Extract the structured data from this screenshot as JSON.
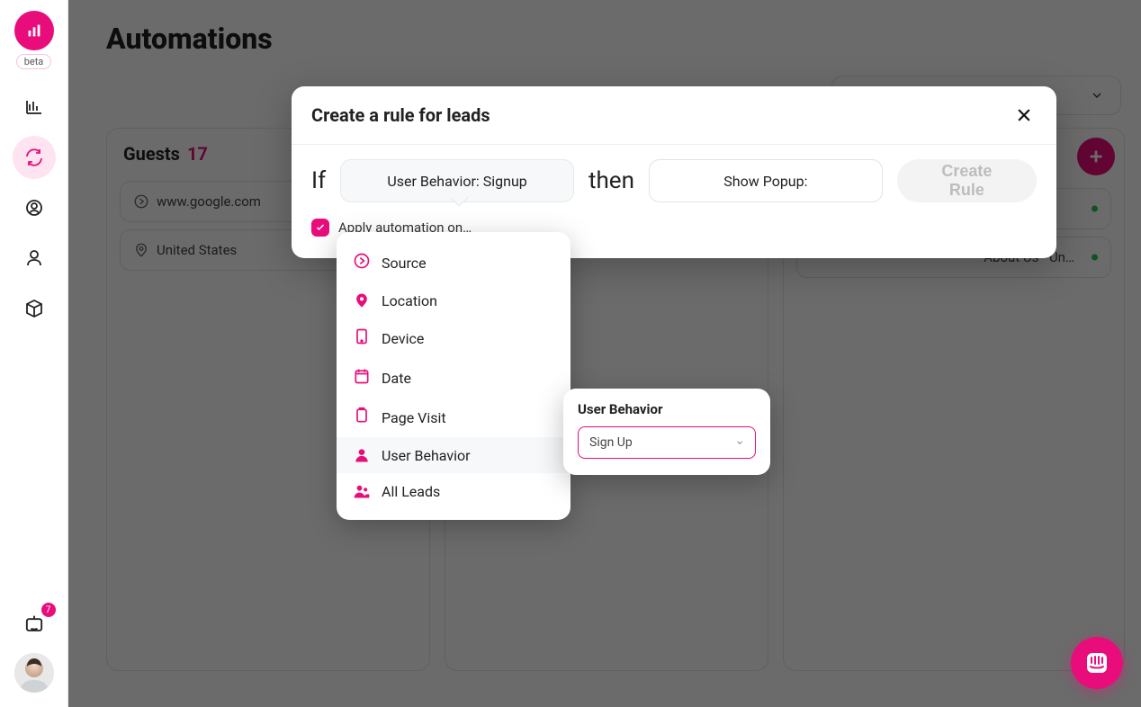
{
  "brand": {
    "beta_label": "beta",
    "accent": "#e90d7b"
  },
  "sidebar": {
    "bot_badge": "7"
  },
  "page": {
    "title": "Automations"
  },
  "columns": {
    "guests": {
      "title": "Guests",
      "count": "17",
      "pills": [
        {
          "icon": "source",
          "text": "www.google.com"
        },
        {
          "icon": "location",
          "text": "United States"
        }
      ]
    },
    "col3": {
      "pills": [
        {
          "text": ""
        },
        {
          "text": "About Us - Un…"
        }
      ]
    }
  },
  "modal": {
    "title": "Create a rule for leads",
    "if_word": "If",
    "if_value": "User Behavior: Signup",
    "then_word": "then",
    "then_value": "Show Popup:",
    "create_label": "Create Rule",
    "apply_label": "Apply automation on…"
  },
  "trigger_menu": {
    "items": [
      {
        "id": "source",
        "label": "Source"
      },
      {
        "id": "location",
        "label": "Location"
      },
      {
        "id": "device",
        "label": "Device"
      },
      {
        "id": "date",
        "label": "Date"
      },
      {
        "id": "page-visit",
        "label": "Page Visit"
      },
      {
        "id": "user-behavior",
        "label": "User Behavior"
      },
      {
        "id": "all-leads",
        "label": "All Leads"
      }
    ]
  },
  "subpop": {
    "heading": "User Behavior",
    "select_value": "Sign Up"
  }
}
